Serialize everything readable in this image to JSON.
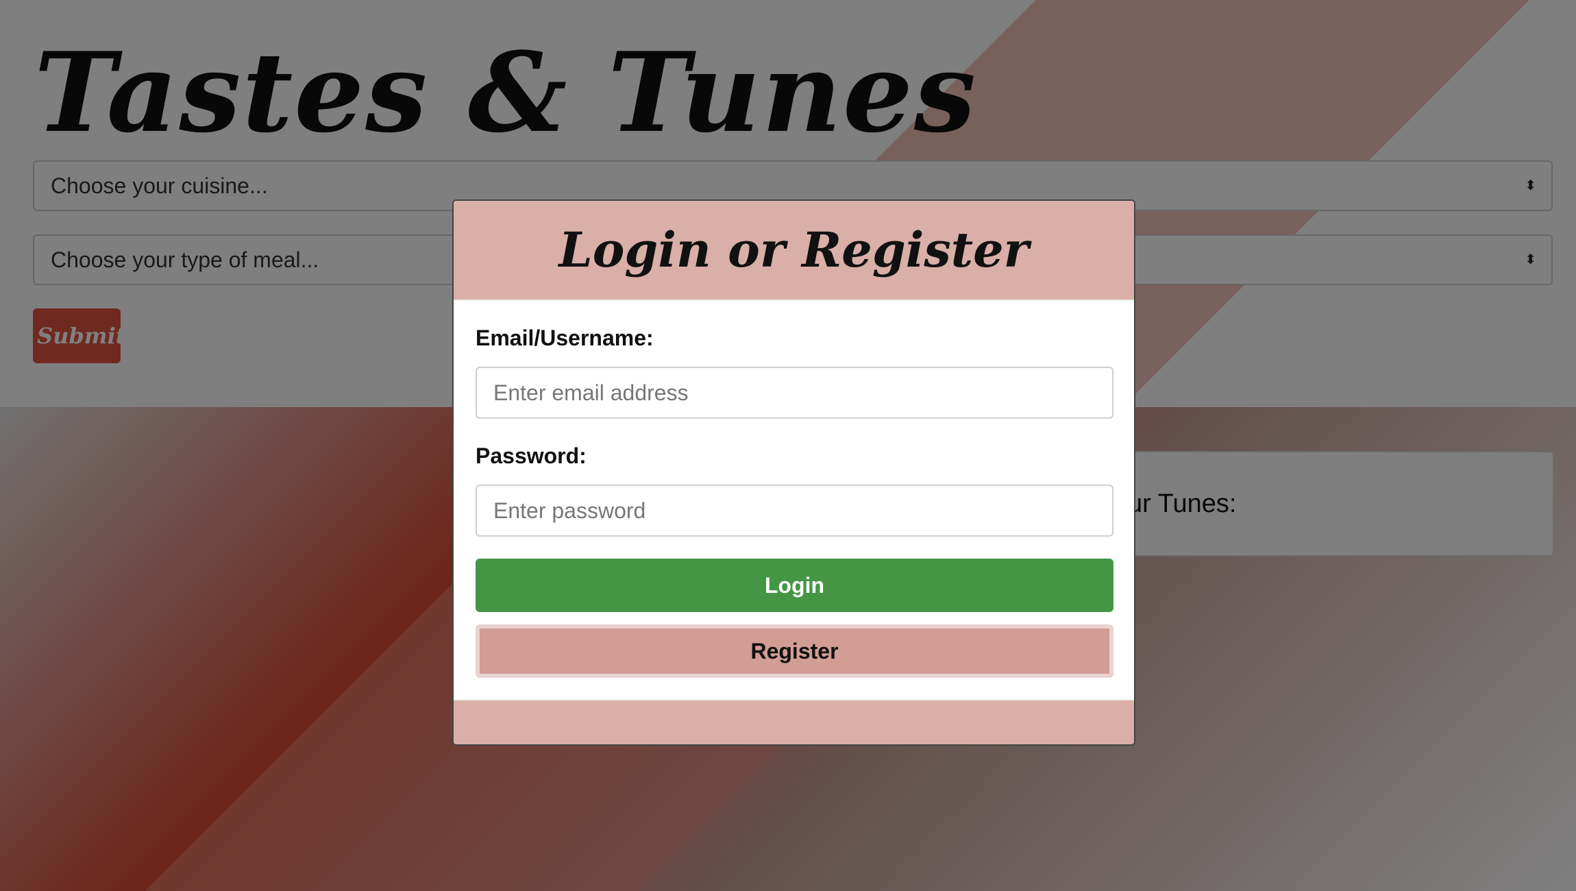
{
  "app": {
    "title": "Tastes & Tunes"
  },
  "form": {
    "cuisine_select": "Choose your cuisine...",
    "meal_select": "Choose your type of meal...",
    "submit_label": "Submit"
  },
  "tunes": {
    "label_visible": "ur Tunes:"
  },
  "modal": {
    "title": "Login or Register",
    "email_label": "Email/Username:",
    "email_placeholder": "Enter email address",
    "password_label": "Password:",
    "password_placeholder": "Enter password",
    "login_label": "Login",
    "register_label": "Register"
  },
  "colors": {
    "accent_red": "#e0533f",
    "modal_header": "#d9afa7",
    "login_green": "#449645",
    "register_pink": "#d29d94"
  }
}
